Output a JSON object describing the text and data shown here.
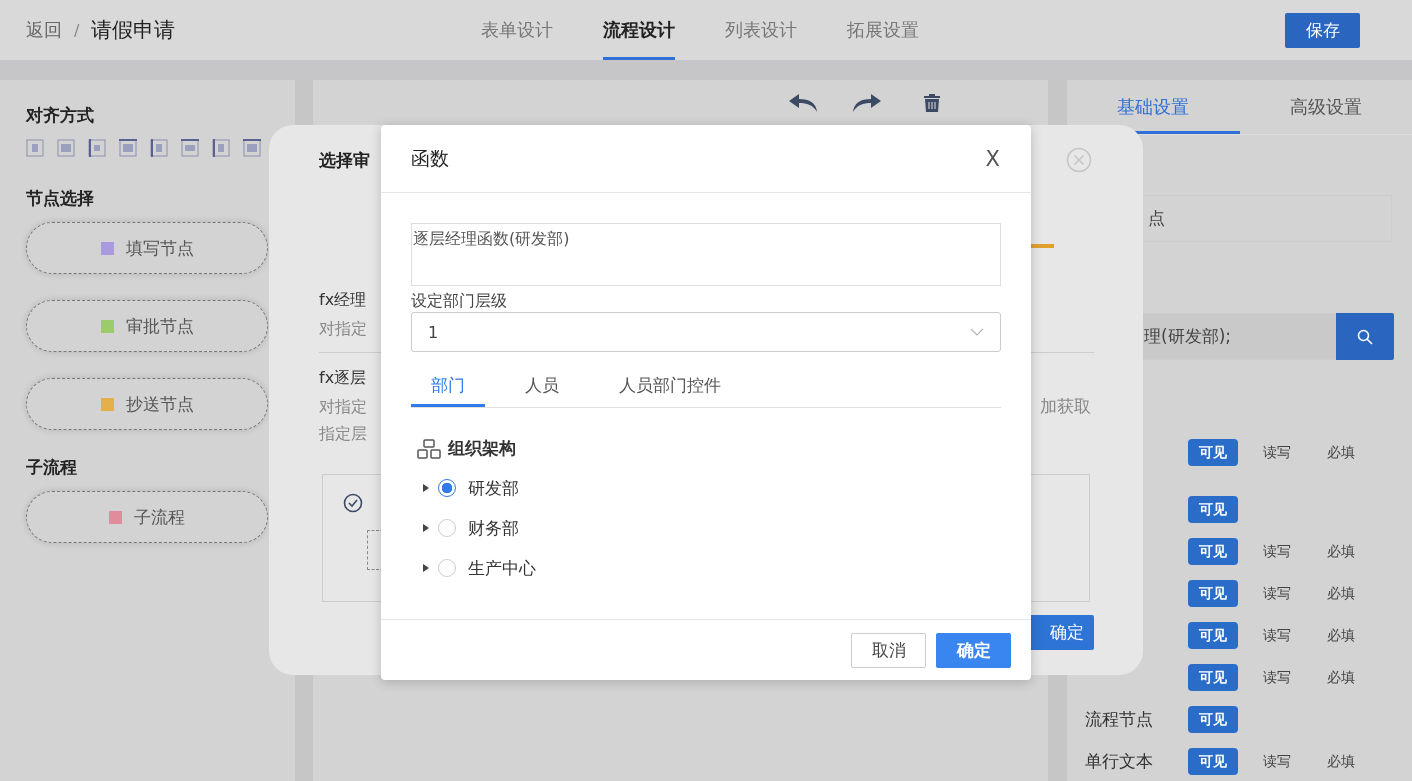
{
  "header": {
    "back": "返回",
    "separator": "/",
    "title": "请假申请",
    "save": "保存",
    "tabs": [
      {
        "label": "表单设计",
        "selected": false
      },
      {
        "label": "流程设计",
        "selected": true
      },
      {
        "label": "列表设计",
        "selected": false
      },
      {
        "label": "拓展设置",
        "selected": false
      }
    ]
  },
  "left_panel": {
    "align_title": "对齐方式",
    "node_title": "节点选择",
    "nodes": [
      {
        "label": "填写节点",
        "color": "#a99bde"
      },
      {
        "label": "审批节点",
        "color": "#9ccc6a"
      },
      {
        "label": "抄送节点",
        "color": "#e5b04a"
      }
    ],
    "subflow_title": "子流程",
    "subflow_nodes": [
      {
        "label": "子流程",
        "color": "#e08c9c"
      }
    ]
  },
  "right_panel": {
    "tabs": [
      {
        "label": "基础设置",
        "selected": true
      },
      {
        "label": "高级设置",
        "selected": false
      }
    ],
    "name_value": "点",
    "search_value": "理(研发部);",
    "permission_rows": [
      {
        "options": [
          {
            "label": "可见",
            "selected": true
          },
          {
            "label": "读写",
            "selected": false
          },
          {
            "label": "必填",
            "selected": false
          }
        ]
      },
      {
        "options": [
          {
            "label": "可见",
            "selected": true
          }
        ]
      },
      {
        "options": [
          {
            "label": "可见",
            "selected": true
          },
          {
            "label": "读写",
            "selected": false
          },
          {
            "label": "必填",
            "selected": false
          }
        ]
      },
      {
        "options": [
          {
            "label": "可见",
            "selected": true
          },
          {
            "label": "读写",
            "selected": false
          },
          {
            "label": "必填",
            "selected": false
          }
        ]
      },
      {
        "options": [
          {
            "label": "可见",
            "selected": true
          },
          {
            "label": "读写",
            "selected": false
          },
          {
            "label": "必填",
            "selected": false
          }
        ]
      },
      {
        "options": [
          {
            "label": "可见",
            "selected": true
          },
          {
            "label": "读写",
            "selected": false
          },
          {
            "label": "必填",
            "selected": false
          }
        ]
      },
      {
        "label": "流程节点",
        "options": [
          {
            "label": "可见",
            "selected": true
          }
        ]
      },
      {
        "label": "单行文本",
        "options": [
          {
            "label": "可见",
            "selected": true
          },
          {
            "label": "读写",
            "selected": false
          },
          {
            "label": "必填",
            "selected": false
          }
        ]
      }
    ]
  },
  "approver_dialog": {
    "title": "选择审",
    "items": [
      {
        "title": "fx经理",
        "desc_lines": [
          "对指定"
        ]
      },
      {
        "title": "fx逐层",
        "desc_lines": [
          "对指定",
          "指定层"
        ],
        "desc_right": "加获取"
      }
    ],
    "confirm": "确定"
  },
  "function_dialog": {
    "title": "函数",
    "close": "X",
    "expression": "逐层经理函数(研发部)",
    "level_label": "设定部门层级",
    "level_value": "1",
    "tabs": [
      {
        "label": "部门",
        "selected": true
      },
      {
        "label": "人员",
        "selected": false
      },
      {
        "label": "人员部门控件",
        "selected": false
      }
    ],
    "tree_title": "组织架构",
    "tree": [
      {
        "label": "研发部",
        "selected": true,
        "expanded": false
      },
      {
        "label": "财务部",
        "selected": false,
        "expanded": false
      },
      {
        "label": "生产中心",
        "selected": false,
        "expanded": false
      }
    ],
    "cancel": "取消",
    "confirm": "确定"
  }
}
